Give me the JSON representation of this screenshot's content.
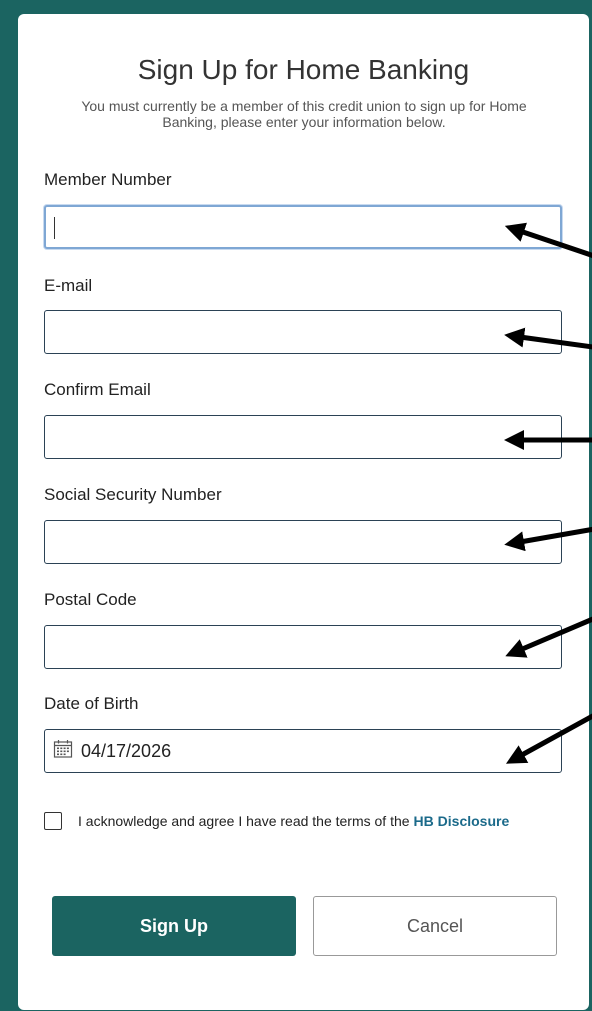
{
  "form": {
    "title": "Sign Up for Home Banking",
    "subtitle": "You must currently be a member of this credit union to sign up for Home Banking, please enter your information below.",
    "fields": [
      {
        "label": "Member Number",
        "value": ""
      },
      {
        "label": "E-mail",
        "value": ""
      },
      {
        "label": "Confirm Email",
        "value": ""
      },
      {
        "label": "Social Security Number",
        "value": ""
      },
      {
        "label": "Postal Code",
        "value": ""
      },
      {
        "label": "Date of Birth",
        "value": "04/17/2026"
      }
    ],
    "agreement": {
      "text": "I acknowledge and agree I have read the terms of the",
      "link": "HB Disclosure",
      "checked": false
    },
    "buttons": {
      "signup": "Sign Up",
      "cancel": "Cancel"
    }
  },
  "colors": {
    "brand": "#1b6461",
    "link": "#1b6a8a",
    "focus_border": "#7fa7d4"
  },
  "icons": {
    "date": "calendar-icon",
    "annotation": "arrow-annotation"
  }
}
